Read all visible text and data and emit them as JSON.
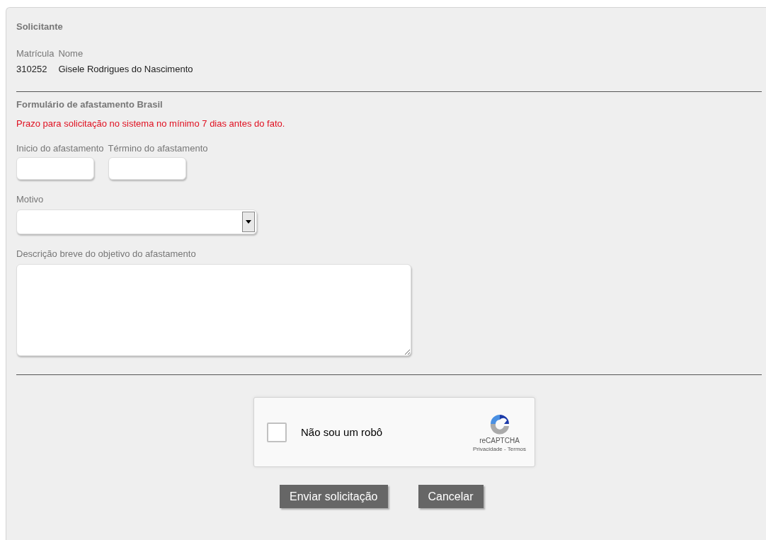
{
  "requester": {
    "title": "Solicitante",
    "columns": [
      {
        "label": "Matrícula",
        "value": "310252"
      },
      {
        "label": "Nome",
        "value": "Gisele Rodrigues do Nascimento"
      }
    ]
  },
  "form": {
    "title": "Formulário de afastamento Brasil",
    "notice": "Prazo para solicitação no sistema no mínimo 7 dias antes do fato.",
    "dates": [
      {
        "label": "Inicio do afastamento"
      },
      {
        "label": "Término do afastamento"
      }
    ],
    "reason": {
      "label": "Motivo"
    },
    "description": {
      "label": "Descrição breve do objetivo do afastamento"
    }
  },
  "captcha": {
    "label": "Não sou um robô",
    "checked": false,
    "brand": "reCAPTCHA",
    "links": "Privacidade - Termos"
  },
  "buttons": [
    {
      "label": "Enviar solicitação"
    },
    {
      "label": "Cancelar"
    }
  ]
}
